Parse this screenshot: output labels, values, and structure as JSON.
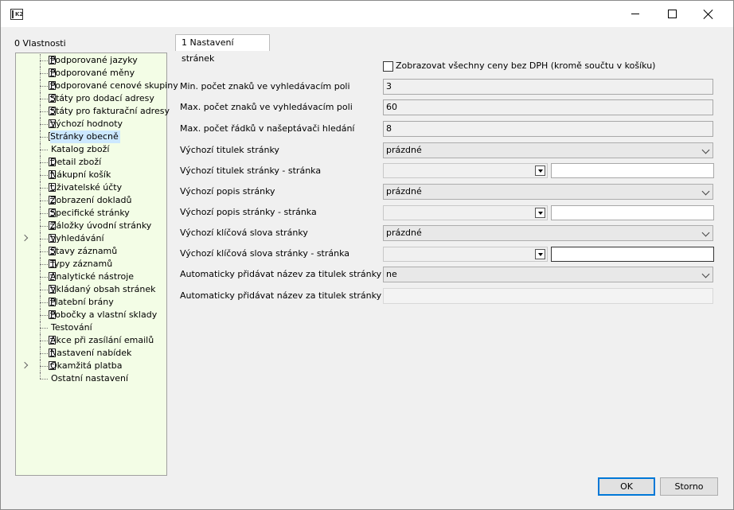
{
  "window": {
    "app_icon_text": "K2"
  },
  "tree": {
    "caption": "0 Vlastnosti",
    "items": [
      {
        "label": "Podporované jazyky",
        "doc": true,
        "expander": false
      },
      {
        "label": "Podporované měny",
        "doc": true,
        "expander": false
      },
      {
        "label": "Podporované cenové skupiny",
        "doc": true,
        "expander": false
      },
      {
        "label": "Státy pro dodací adresy",
        "doc": true,
        "expander": false
      },
      {
        "label": "Státy pro fakturační adresy",
        "doc": true,
        "expander": false
      },
      {
        "label": "Výchozí hodnoty",
        "doc": true,
        "expander": false
      },
      {
        "label": "Stránky obecně",
        "doc": true,
        "expander": false,
        "selected": true
      },
      {
        "label": "Katalog zboží",
        "doc": false,
        "expander": false
      },
      {
        "label": "Detail zboží",
        "doc": true,
        "expander": false
      },
      {
        "label": "Nákupní košík",
        "doc": true,
        "expander": false
      },
      {
        "label": "Uživatelské účty",
        "doc": true,
        "expander": false
      },
      {
        "label": "Zobrazení dokladů",
        "doc": true,
        "expander": false
      },
      {
        "label": "Specifické stránky",
        "doc": true,
        "expander": false
      },
      {
        "label": "Záložky úvodní stránky",
        "doc": true,
        "expander": false
      },
      {
        "label": "Vyhledávání",
        "doc": true,
        "expander": true
      },
      {
        "label": "Stavy záznamů",
        "doc": true,
        "expander": false
      },
      {
        "label": "Typy záznamů",
        "doc": true,
        "expander": false
      },
      {
        "label": "Analytické nástroje",
        "doc": true,
        "expander": false
      },
      {
        "label": "Vkládaný obsah stránek",
        "doc": true,
        "expander": false
      },
      {
        "label": "Platební brány",
        "doc": true,
        "expander": false
      },
      {
        "label": "Pobočky a vlastní sklady",
        "doc": true,
        "expander": false
      },
      {
        "label": "Testování",
        "doc": false,
        "expander": false
      },
      {
        "label": "Akce při zasílání emailů",
        "doc": true,
        "expander": false
      },
      {
        "label": "Nastavení nabídek",
        "doc": true,
        "expander": false
      },
      {
        "label": "Okamžitá platba",
        "doc": true,
        "expander": true
      },
      {
        "label": "Ostatní nastavení",
        "doc": false,
        "expander": false
      }
    ]
  },
  "tab": {
    "label": "1 Nastavení stránek"
  },
  "form": {
    "checkbox_label": "Zobrazovat všechny ceny bez DPH (kromě součtu v košíku)",
    "min_chars_label": "Min. počet znaků ve vyhledávacím poli",
    "min_chars_value": "3",
    "max_chars_label": "Max. počet znaků ve vyhledávacím poli",
    "max_chars_value": "60",
    "max_rows_label": "Max. počet řádků v našeptávači hledání",
    "max_rows_value": "8",
    "title_label": "Výchozí titulek stránky",
    "title_value": "prázdné",
    "title_page_label": "Výchozí titulek stránky - stránka",
    "desc_label": "Výchozí popis stránky",
    "desc_value": "prázdné",
    "desc_page_label": "Výchozí popis stránky - stránka",
    "keywords_label": "Výchozí klíčová slova stránky",
    "keywords_value": "prázdné",
    "keywords_page_label": "Výchozí klíčová slova stránky - stránka",
    "auto_name_label": "Automaticky přidávat název za titulek stránky",
    "auto_name_value": "ne",
    "auto_name2_label": "Automaticky přidávat název za titulek stránky - vl..."
  },
  "buttons": {
    "ok": "OK",
    "cancel": "Storno"
  }
}
